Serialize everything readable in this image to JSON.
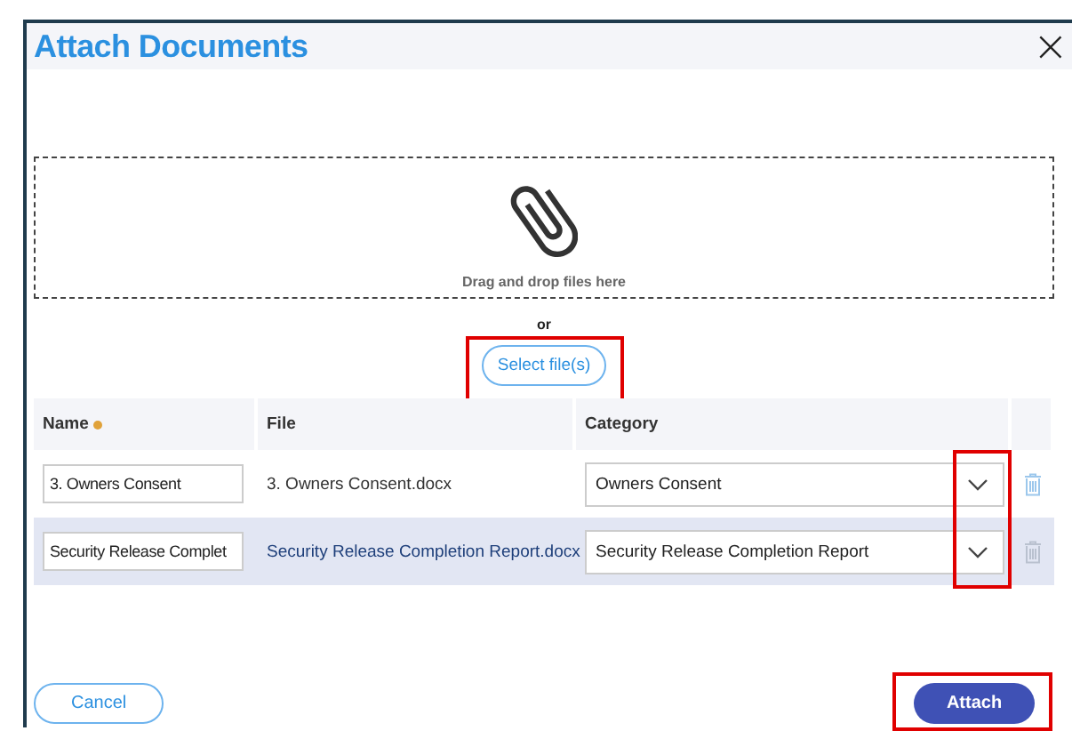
{
  "dialog": {
    "title": "Attach Documents",
    "close": "×"
  },
  "dropzone": {
    "hint": "Drag and drop files here"
  },
  "separator": "or",
  "select_button": {
    "label": "Select file(s)",
    "highlighted": true
  },
  "table": {
    "columns": [
      {
        "label": "Name",
        "required": true
      },
      {
        "label": "File",
        "required": false
      },
      {
        "label": "Category",
        "required": false
      }
    ],
    "chevrons_highlighted": true,
    "rows": [
      {
        "name": "3. Owners Consent",
        "file": "3. Owners Consent.docx",
        "category": "Owners Consent",
        "selected": false
      },
      {
        "name": "Security Release Complet",
        "file": "Security Release Completion Report.docx",
        "category": "Security Release Completion Report",
        "selected": true
      }
    ]
  },
  "buttons": [
    {
      "label": "Cancel",
      "kind": "secondary",
      "highlighted": false
    },
    {
      "label": "Attach",
      "kind": "primary",
      "highlighted": true
    }
  ]
}
